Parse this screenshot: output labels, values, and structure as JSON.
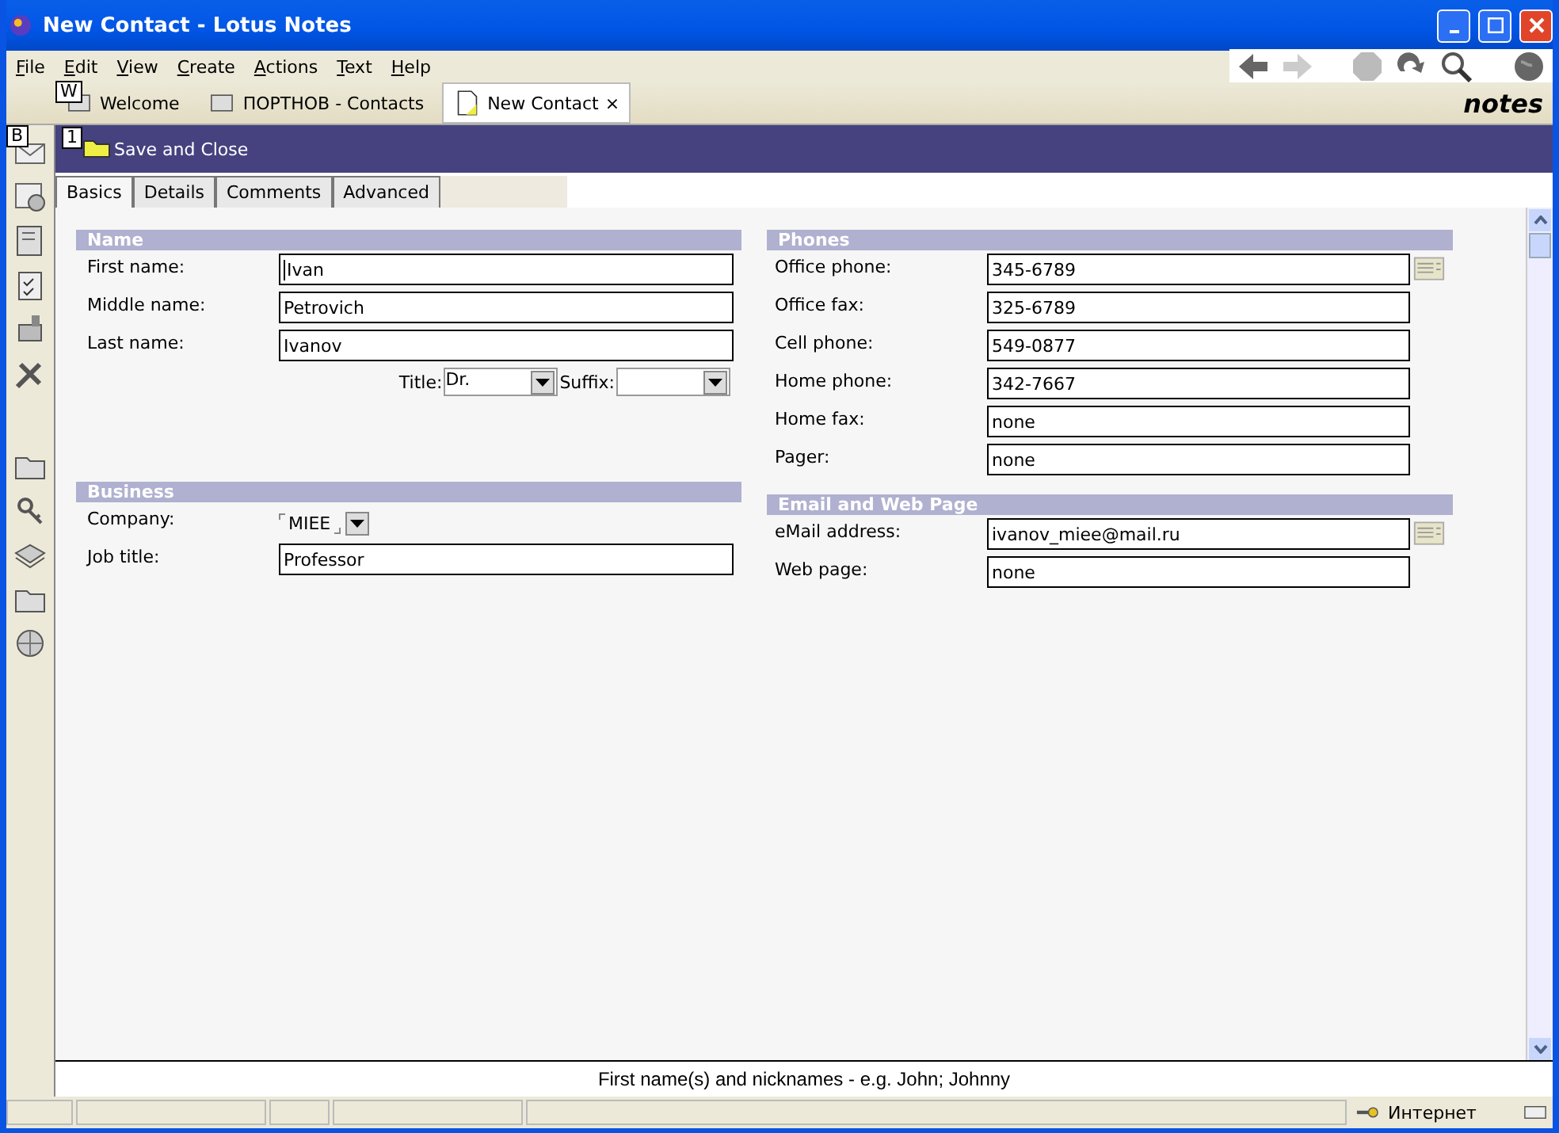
{
  "window": {
    "title": "New Contact - Lotus Notes"
  },
  "menu": [
    "File",
    "Edit",
    "View",
    "Create",
    "Actions",
    "Text",
    "Help"
  ],
  "doc_tabs": [
    {
      "label": "Welcome",
      "key": "W",
      "selected": false,
      "closable": false
    },
    {
      "label": "ПОРТНОВ - Contacts",
      "selected": false,
      "closable": false
    },
    {
      "label": "New Contact",
      "selected": true,
      "closable": true
    }
  ],
  "close_mark": "×",
  "brand": "notes",
  "rail_key": "B",
  "actions": [
    {
      "label": "Save and Close",
      "key": "1"
    }
  ],
  "form_tabs": [
    {
      "label": "Basics",
      "selected": true
    },
    {
      "label": "Details",
      "selected": false
    },
    {
      "label": "Comments",
      "selected": false
    },
    {
      "label": "Advanced",
      "selected": false
    }
  ],
  "columns": [
    [
      {
        "title": "Name",
        "rows": [
          {
            "kind": "text",
            "label": "First name:",
            "value": "Ivan",
            "focused": true
          },
          {
            "kind": "text",
            "label": "Middle name:",
            "value": "Petrovich",
            "focused": false
          },
          {
            "kind": "text",
            "label": "Last name:",
            "value": "Ivanov",
            "focused": false
          },
          {
            "kind": "dropdowns",
            "items": [
              {
                "label": "Title:",
                "value": "Dr."
              },
              {
                "label": "Suffix:"
              }
            ]
          }
        ]
      },
      {
        "title": "Business",
        "rows": [
          {
            "kind": "keyword",
            "label": "Company:",
            "value": "MIEE"
          },
          {
            "kind": "text",
            "label": "Job title:",
            "value": "Professor",
            "focused": false
          }
        ]
      }
    ],
    [
      {
        "title": "Phones",
        "rows": [
          {
            "kind": "lookup",
            "label": "Office phone:",
            "value": "345-6789"
          },
          {
            "kind": "text",
            "label": "Office fax:",
            "value": "325-6789",
            "focused": false
          },
          {
            "kind": "text",
            "label": "Cell phone:",
            "value": "549-0877",
            "focused": false
          },
          {
            "kind": "text",
            "label": "Home phone:",
            "value": "342-7667",
            "focused": false
          },
          {
            "kind": "text",
            "label": "Home fax:",
            "value": "none",
            "focused": false
          },
          {
            "kind": "text",
            "label": "Pager:",
            "value": "none",
            "focused": false
          }
        ]
      },
      {
        "title": "Email and Web Page",
        "rows": [
          {
            "kind": "lookup",
            "label": "eMail address:",
            "value": "ivanov_miee@mail.ru"
          },
          {
            "kind": "text",
            "label": "Web page:",
            "value": "none",
            "focused": false
          }
        ]
      }
    ]
  ],
  "hint": "First name(s) and nicknames - e.g. John; Johnny",
  "status_bar": {
    "zone": "Интернет"
  }
}
